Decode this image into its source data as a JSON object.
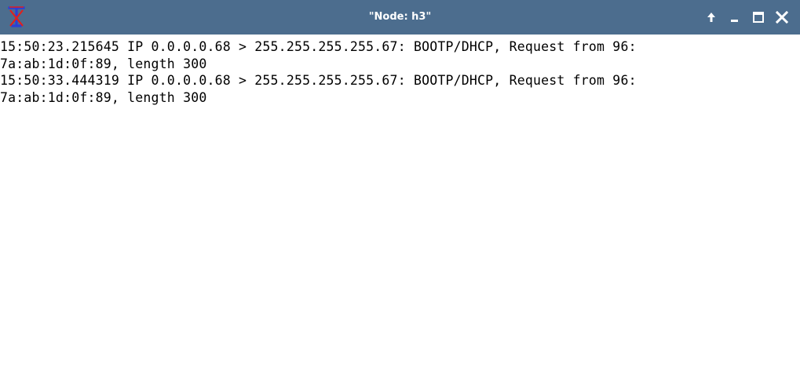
{
  "window": {
    "title": "\"Node: h3\"",
    "app_icon": "xterm-t-icon",
    "controls": [
      {
        "name": "raise-button",
        "icon": "up-arrow-icon"
      },
      {
        "name": "minimize-button",
        "icon": "minimize-icon"
      },
      {
        "name": "maximize-button",
        "icon": "maximize-icon"
      },
      {
        "name": "close-button",
        "icon": "close-icon"
      }
    ],
    "colors": {
      "titlebar": "#4c6d8e",
      "title_text": "#ffffff",
      "icon_red": "#e0201e",
      "icon_blue": "#2b3fd6"
    }
  },
  "terminal": {
    "lines": [
      "15:50:23.215645 IP 0.0.0.0.68 > 255.255.255.255.67: BOOTP/DHCP, Request from 96:",
      "7a:ab:1d:0f:89, length 300",
      "15:50:33.444319 IP 0.0.0.0.68 > 255.255.255.255.67: BOOTP/DHCP, Request from 96:",
      "7a:ab:1d:0f:89, length 300"
    ]
  }
}
